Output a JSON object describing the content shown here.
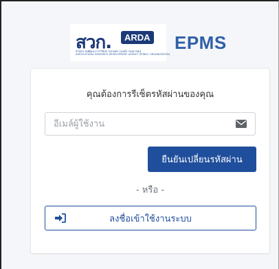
{
  "header": {
    "logo_thai": "สวก.",
    "logo_badge": "ARDA",
    "logo_sub1": "สำนักงานพัฒนาการวิจัยการเกษตร (องค์การมหาชน)",
    "logo_sub2": "AGRICULTURAL RESEARCH DEVELOPMENT AGENCY (PUBLIC ORGANIZATION)",
    "app_title": "EPMS"
  },
  "form": {
    "prompt": "คุณต้องการรีเซ็ตรหัสผ่านของคุณ",
    "username_placeholder": "อีเมล์ผู้ใช้งาน",
    "username_value": "",
    "submit_label": "ยืนยันเปลี่ยนรหัสผ่าน",
    "or_text": "- หรือ -",
    "login_label": "ลงชื่อเข้าใช้งานระบบ"
  },
  "icons": {
    "email": "envelope-icon",
    "login": "sign-in-icon"
  },
  "colors": {
    "brand_blue": "#1d3a78",
    "title_blue": "#2f5fa7",
    "primary_button": "#1f4e9c",
    "page_bg": "#f4f6f9"
  }
}
